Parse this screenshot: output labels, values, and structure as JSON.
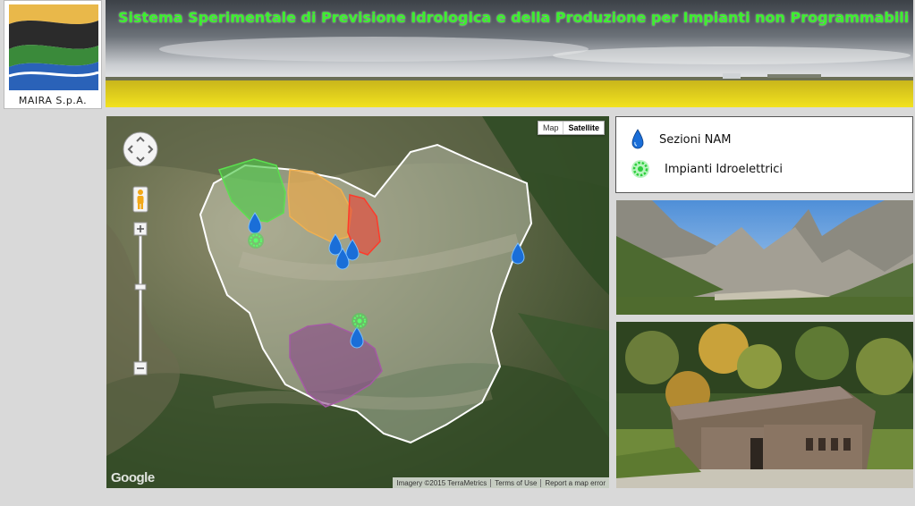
{
  "logo": {
    "text": "MAIRA S.p.A."
  },
  "banner": {
    "title": "Sistema Sperimentale di Previsione Idrologica e della Produzione per Impianti non Programmabili"
  },
  "map": {
    "type_controls": [
      "Map",
      "Satellite"
    ],
    "selected_type": "Satellite",
    "brand": "Google",
    "footer": [
      "Imagery ©2015 TerraMetrics",
      "Terms of Use",
      "Report a map error"
    ],
    "colors": {
      "green_basin": "#4fc94a",
      "orange_basin": "#e8a84a",
      "red_basin": "#e84a3a",
      "purple_basin": "#8a4a8a",
      "outline": "#ffffff"
    }
  },
  "legend": {
    "items": [
      {
        "label": "Sezioni NAM",
        "icon": "water-drop-icon",
        "color": "#1a6ed8"
      },
      {
        "label": "Impianti Idroelettrici",
        "icon": "turbine-gear-icon",
        "color": "#39e04a"
      }
    ]
  },
  "photos": [
    {
      "name": "mountain-valley-photo"
    },
    {
      "name": "hydro-plant-photo"
    }
  ]
}
